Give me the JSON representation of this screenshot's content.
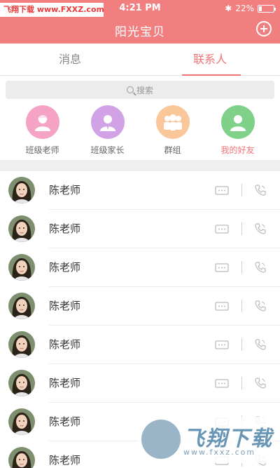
{
  "status_bar": {
    "watermark": "飞翔下载 www.FXXZ.com",
    "time": "4:21 PM",
    "bluetooth_icon": "bluetooth-icon",
    "battery_text": "22%",
    "battery_level": 0.22
  },
  "nav": {
    "title": "阳光宝贝",
    "add_icon": "add-circle-icon"
  },
  "tabs": [
    {
      "label": "消息",
      "active": false
    },
    {
      "label": "联系人",
      "active": true
    }
  ],
  "search": {
    "placeholder": "搜索"
  },
  "categories": [
    {
      "label": "班级老师",
      "color": "#f4a3c4",
      "icon": "teacher-icon"
    },
    {
      "label": "班级家长",
      "color": "#d1a2e6",
      "icon": "parent-icon"
    },
    {
      "label": "群组",
      "color": "#f9c79a",
      "icon": "group-icon"
    },
    {
      "label": "我的好友",
      "color": "#7fd18a",
      "icon": "friend-icon",
      "active": true
    }
  ],
  "contacts": [
    {
      "name": "陈老师"
    },
    {
      "name": "陈老师"
    },
    {
      "name": "陈老师"
    },
    {
      "name": "陈老师"
    },
    {
      "name": "陈老师"
    },
    {
      "name": "陈老师"
    },
    {
      "name": "陈老师"
    },
    {
      "name": "陈老师"
    }
  ],
  "watermark_bottom": {
    "brand": "飞翔下载",
    "url": "www.fxxz.com"
  },
  "colors": {
    "accent": "#f27f7f",
    "tab_active": "#f27373"
  }
}
